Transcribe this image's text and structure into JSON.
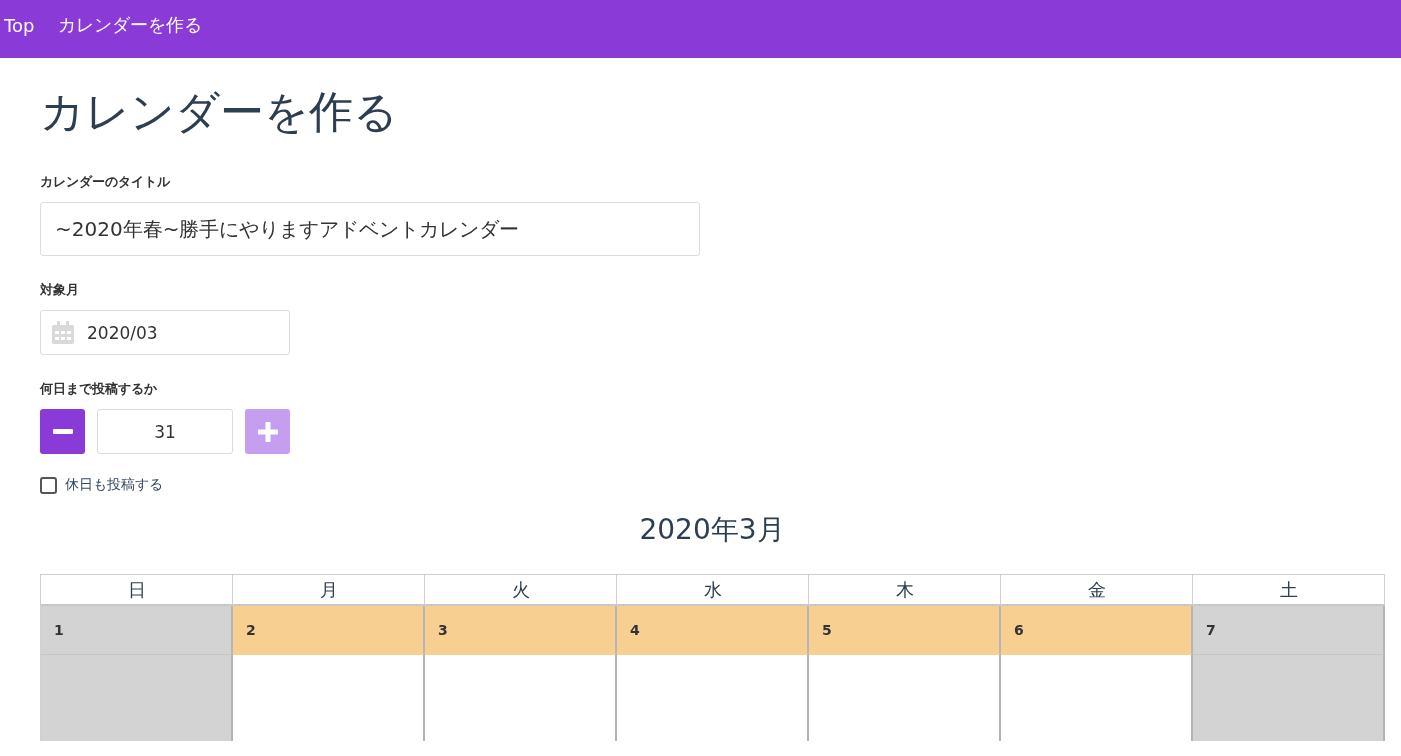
{
  "nav": {
    "items": [
      {
        "label": "Top"
      },
      {
        "label": "カレンダーを作る"
      }
    ]
  },
  "heading": "カレンダーを作る",
  "title_field": {
    "label": "カレンダーのタイトル",
    "value": "~2020年春~勝手にやりますアドベントカレンダー"
  },
  "month_field": {
    "label": "対象月",
    "value": "2020/03"
  },
  "days_field": {
    "label": "何日まで投稿するか",
    "value": "31",
    "minus_disabled": false,
    "plus_disabled": true
  },
  "holiday_checkbox": {
    "label": "休日も投稿する",
    "checked": false
  },
  "calendar": {
    "title": "2020年3月",
    "weekdays": [
      "日",
      "月",
      "火",
      "水",
      "木",
      "金",
      "土"
    ],
    "days": [
      {
        "day": "1",
        "holiday": true
      },
      {
        "day": "2",
        "holiday": false
      },
      {
        "day": "3",
        "holiday": false
      },
      {
        "day": "4",
        "holiday": false
      },
      {
        "day": "5",
        "holiday": false
      },
      {
        "day": "6",
        "holiday": false
      },
      {
        "day": "7",
        "holiday": true
      }
    ]
  }
}
